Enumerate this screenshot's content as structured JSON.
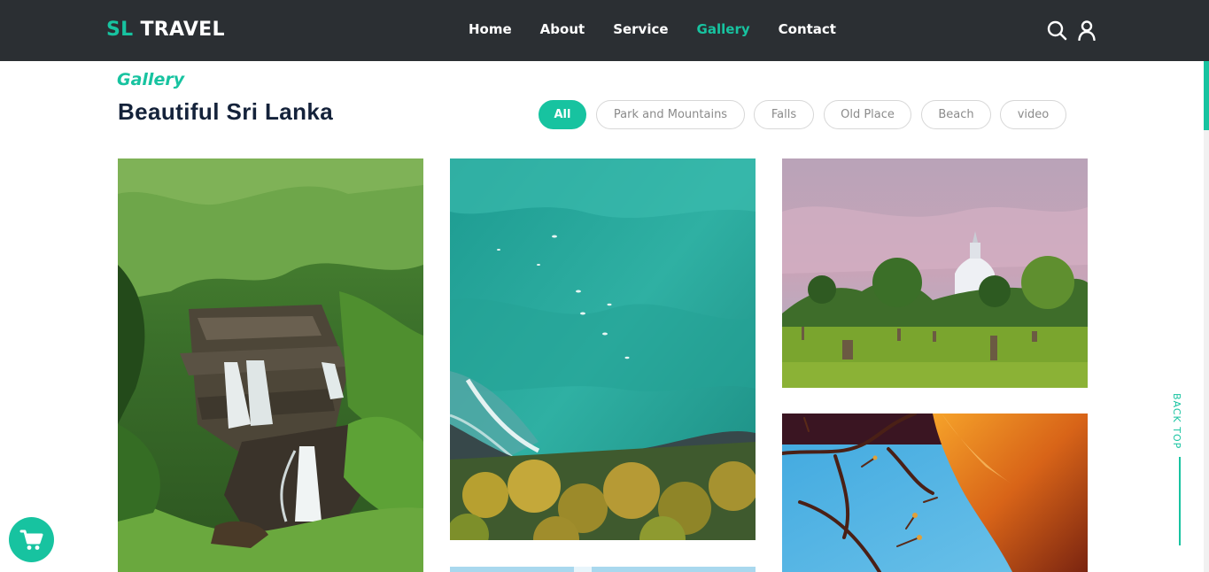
{
  "navbar": {
    "brand_sl": "SL",
    "brand_travel": "TRAVEL",
    "links": [
      {
        "label": "Home",
        "active": false
      },
      {
        "label": "About",
        "active": false
      },
      {
        "label": "Service",
        "active": false
      },
      {
        "label": "Gallery",
        "active": true
      },
      {
        "label": "Contact",
        "active": false
      }
    ],
    "icons": [
      "search-icon",
      "user-icon"
    ]
  },
  "gallery": {
    "subtitle": "Gallery",
    "title": "Beautiful Sri Lanka",
    "filters": [
      {
        "label": "All",
        "active": true
      },
      {
        "label": "Park and Mountains",
        "active": false
      },
      {
        "label": "Falls",
        "active": false
      },
      {
        "label": "Old Place",
        "active": false
      },
      {
        "label": "Beach",
        "active": false
      },
      {
        "label": "video",
        "active": false
      }
    ],
    "photos": [
      {
        "name": "waterfall-photo",
        "subject": "waterfall in green hills"
      },
      {
        "name": "ocean-aerial-photo",
        "subject": "aerial view of turquoise ocean and palms"
      },
      {
        "name": "stupa-photo",
        "subject": "white stupa with park at dusk"
      },
      {
        "name": "flower-tree-photo",
        "subject": "tree branches against blue sky"
      },
      {
        "name": "beach-photo",
        "subject": "beach partially visible"
      }
    ]
  },
  "back_top": {
    "label": "BACK TOP"
  },
  "cart": {
    "icon": "cart-icon"
  },
  "colors": {
    "accent": "#17c3a0",
    "navbar_bg": "#2b2f33",
    "title": "#14223a"
  }
}
